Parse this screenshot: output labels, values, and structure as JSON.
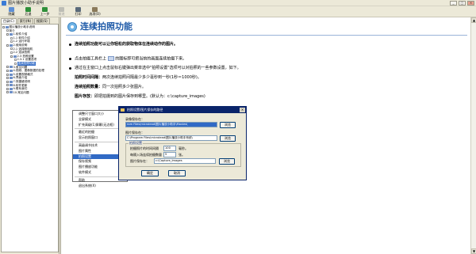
{
  "window": {
    "title": "图片播放小助手说明",
    "min": "_",
    "max": "□",
    "close": "×"
  },
  "toolbar": {
    "buttons": [
      {
        "label": "隐藏",
        "color": "#5d8fd6",
        "enabled": true
      },
      {
        "label": "后退",
        "color": "#2f8f3a",
        "enabled": true
      },
      {
        "label": "上一步",
        "color": "#2f8f3a",
        "enabled": true
      },
      {
        "label": "前进",
        "color": "#bdbdb5",
        "enabled": false
      },
      {
        "label": "打印",
        "color": "#5a6a7a",
        "enabled": true
      },
      {
        "label": "选项(O)",
        "color": "#8a7a5a",
        "enabled": true
      }
    ]
  },
  "left_panel": {
    "tabs": [
      "目录(C)",
      "索引(N)",
      "搜索(S)"
    ],
    "tree": [
      {
        "label": "图片播放小助手说明",
        "indent": 0,
        "kind": "book"
      },
      {
        "label": "简介",
        "indent": 1,
        "kind": "page"
      },
      {
        "label": "1.软件介绍",
        "indent": 1,
        "kind": "book"
      },
      {
        "label": "1.1 软件介绍",
        "indent": 2,
        "kind": "page"
      },
      {
        "label": "1.2 运行环境",
        "indent": 2,
        "kind": "page"
      },
      {
        "label": "2.使用说明",
        "indent": 1,
        "kind": "book"
      },
      {
        "label": "2.1 选择照相机",
        "indent": 2,
        "kind": "page"
      },
      {
        "label": "2.2 连续拍照",
        "indent": 2,
        "kind": "page"
      },
      {
        "label": "2.3 拍照设置",
        "indent": 2,
        "kind": "book"
      },
      {
        "label": "2.3.1 设置选项",
        "indent": 3,
        "kind": "page"
      },
      {
        "label": "连续拍照功能",
        "indent": 3,
        "kind": "page",
        "selected": true
      },
      {
        "label": "3.常见问题",
        "indent": 1,
        "kind": "book"
      },
      {
        "label": "4.视频、图像数据的处理",
        "indent": 1,
        "kind": "book"
      },
      {
        "label": "5.设置视频格式",
        "indent": 1,
        "kind": "book"
      },
      {
        "label": "6.界面介绍",
        "indent": 1,
        "kind": "book"
      },
      {
        "label": "7.快捷键说明",
        "indent": 1,
        "kind": "book"
      },
      {
        "label": "8.软件更新",
        "indent": 1,
        "kind": "book"
      },
      {
        "label": "9.联系我们",
        "indent": 1,
        "kind": "book"
      },
      {
        "label": "10.常见问题",
        "indent": 1,
        "kind": "book"
      }
    ]
  },
  "content": {
    "title": "连续拍照功能",
    "intro": "连续拍照功能可以让你轻松的获取物体在连续动作的图片。",
    "step1_a": "点击拍摄工具栏上",
    "step1_b": "的图标即可把当前的画面连续拍摄下来。",
    "step2": "通过在主窗口上点击鼠标右键弹出菜单选中\"拍照设置\"选项可以对拍照的一些参数设置，如下。",
    "interval_label": "拍照时间间隔：",
    "interval_text": "两次连续拍照间隔最少多少毫秒到一秒(1秒＝1000秒)。",
    "count_label": "连续拍照数量：",
    "count_text": "同一次拍照多少张图片。",
    "path_label": "图片存放：",
    "path_text": "即把拍摄到的图片保存到哪里。(默认为：c:\\capture_images)"
  },
  "context_menu": {
    "items": [
      {
        "label": "调整尺寸窗口大小",
        "sub": false
      },
      {
        "label": "全屏模式",
        "sub": false
      },
      {
        "label": "扩充高级(1)屏幕(无边框)",
        "sub": false
      },
      {
        "sep": true
      },
      {
        "label": "最近的拍摄",
        "sub": false
      },
      {
        "label": "显示拍照窗口",
        "sub": false
      },
      {
        "sep": true
      },
      {
        "label": "高级调节技术",
        "sub": false
      },
      {
        "label": "图片属性",
        "sub": false
      },
      {
        "label": "拍照设置",
        "sub": false,
        "selected": true
      },
      {
        "label": "保存视频",
        "sub": true
      },
      {
        "label": "图片播放功能",
        "sub": true
      },
      {
        "label": "软件模式",
        "sub": true
      },
      {
        "sep": true
      },
      {
        "label": "帮助",
        "sub": false
      },
      {
        "label": "退出系统(X)",
        "sub": false
      }
    ]
  },
  "dialog": {
    "title": "拍照设置/图片保存的路径",
    "close": "×",
    "video_path_label": "录像保存在：",
    "video_path_value": "rom Files\\microlead\\图片播放小助手\\Movies\\",
    "image_path_label": "图片保存在：",
    "image_path_value": "C:\\Program Files\\microlead\\图片播放小助手系统\\",
    "browse": "浏览",
    "group_label": "拍照设置",
    "interval_label": "拍摄照片的时间间隔",
    "interval_value": "100",
    "interval_unit": "毫秒。",
    "count_label": "每隔入场连续拍摄数量",
    "count_value": "5",
    "count_unit": "张。",
    "save_path_label": "图片保存在：",
    "save_path_value": "c:\\Capture_Images",
    "browse2": "浏览",
    "ok": "确定",
    "cancel": "取消"
  }
}
